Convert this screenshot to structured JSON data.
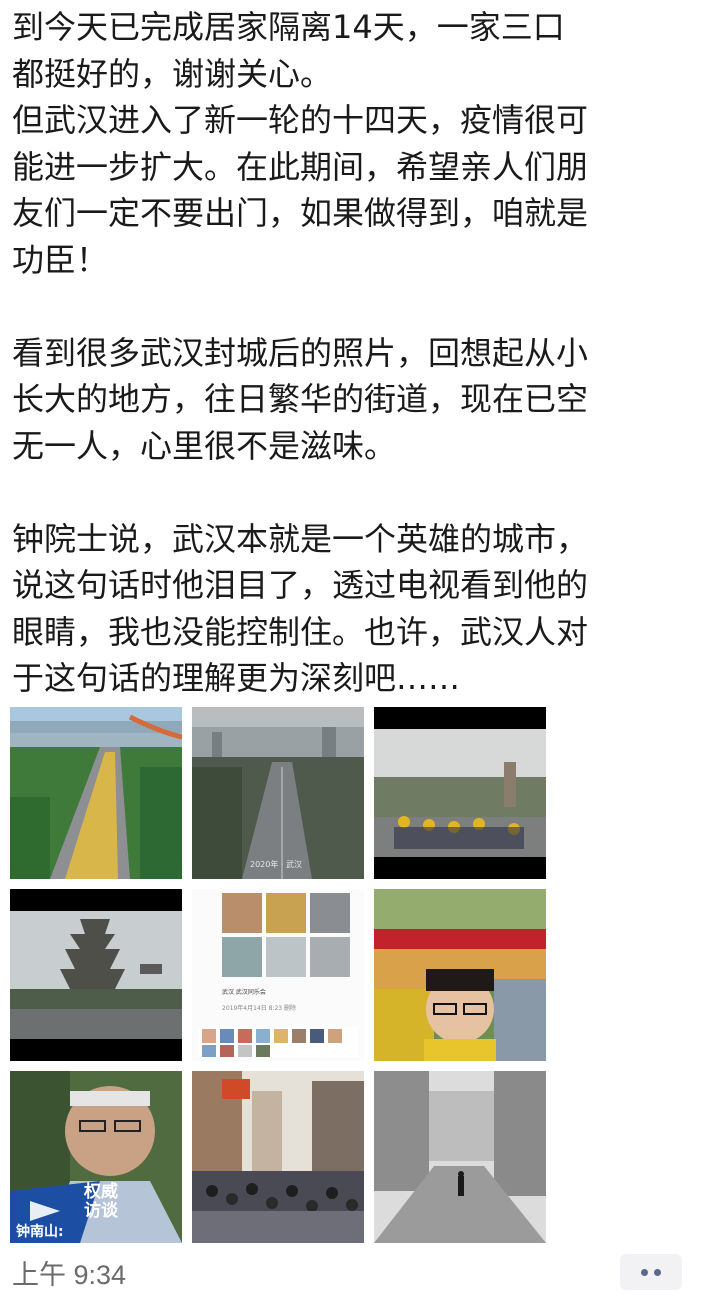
{
  "post": {
    "lines": [
      "到今天已完成居家隔离14天，一家三口",
      "都挺好的，谢谢关心。",
      "但武汉进入了新一轮的十四天，疫情很可",
      "能进一步扩大。在此期间，希望亲人们朋",
      "友们一定不要出门，如果做得到，咱就是",
      "功臣！",
      "",
      "看到很多武汉封城后的照片，回想起从小",
      "长大的地方，往日繁华的街道，现在已空",
      "无一人，心里很不是滋味。",
      "",
      "钟院士说，武汉本就是一个英雄的城市，",
      "说这句话时他泪目了，透过电视看到他的",
      "眼睛，我也没能控制住。也许，武汉人对",
      "于这句话的理解更为深刻吧……"
    ]
  },
  "photos": {
    "photo_2_caption": "2020年 · 武汉",
    "photo_5_date": "2019年4月14日 8:23  删除",
    "photo_5_label": "武汉   武汉同乐会",
    "photo_7_badge": "权威\n访谈",
    "photo_7_badge_line1": "权威",
    "photo_7_badge_line2": "访谈",
    "photo_7_name": "钟南山:"
  },
  "footer": {
    "timestamp": "上午 9:34",
    "more_label": "more"
  },
  "colors": {
    "timestamp": "#6b6b6b",
    "more_bg": "#f2f2f5",
    "more_dot": "#5a6a8c",
    "text": "#1a1a1a"
  }
}
